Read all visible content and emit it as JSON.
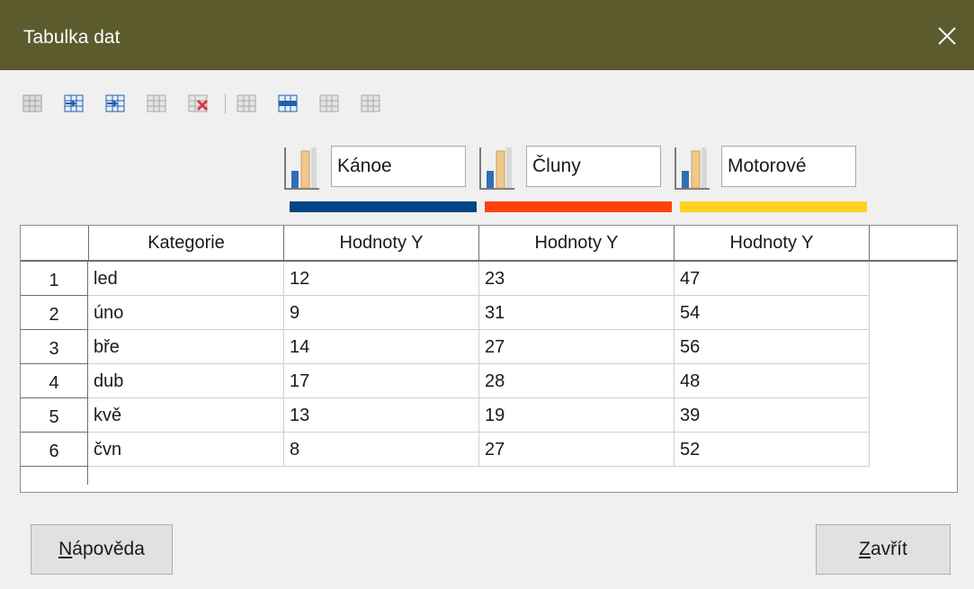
{
  "window": {
    "title": "Tabulka dat"
  },
  "toolbar": {
    "icons": [
      "insert-row-icon",
      "insert-column-icon",
      "insert-text-column-icon",
      "delete-row-icon",
      "delete-column-icon",
      "move-row-down-icon",
      "move-row-up-icon",
      "move-column-right-icon",
      "move-column-left-icon"
    ]
  },
  "series": [
    {
      "name": "Kánoe",
      "color": "#004586"
    },
    {
      "name": "Čluny",
      "color": "#ff420e"
    },
    {
      "name": "Motorové",
      "color": "#ffd320"
    }
  ],
  "table": {
    "headers": [
      "Kategorie",
      "Hodnoty Y",
      "Hodnoty Y",
      "Hodnoty Y"
    ],
    "rows": [
      {
        "num": "1",
        "cells": [
          "led",
          "12",
          "23",
          "47"
        ]
      },
      {
        "num": "2",
        "cells": [
          "úno",
          "9",
          "31",
          "54"
        ]
      },
      {
        "num": "3",
        "cells": [
          "bře",
          "14",
          "27",
          "56"
        ]
      },
      {
        "num": "4",
        "cells": [
          "dub",
          "17",
          "28",
          "48"
        ]
      },
      {
        "num": "5",
        "cells": [
          "kvě",
          "13",
          "19",
          "39"
        ]
      },
      {
        "num": "6",
        "cells": [
          "čvn",
          "8",
          "27",
          "52"
        ]
      }
    ]
  },
  "buttons": {
    "help": {
      "accel": "N",
      "rest": "ápověda"
    },
    "close": {
      "accel": "Z",
      "rest": "avřít"
    }
  }
}
